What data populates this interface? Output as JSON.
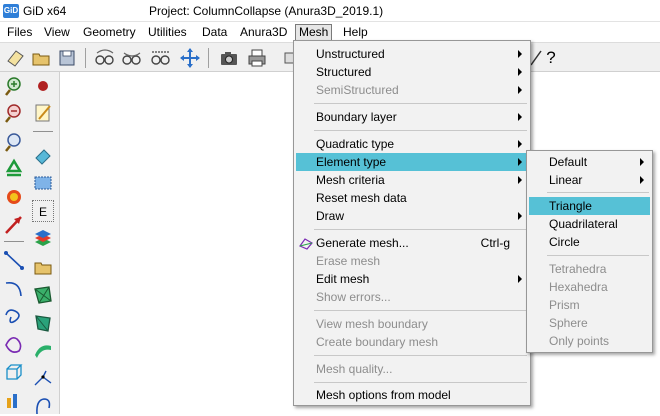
{
  "window": {
    "app_name": "GiD x64",
    "title": "Project: ColumnCollapse (Anura3D_2019.1)"
  },
  "menubar": [
    {
      "label": "Files"
    },
    {
      "label": "View"
    },
    {
      "label": "Geometry"
    },
    {
      "label": "Utilities"
    },
    {
      "label": "Data"
    },
    {
      "label": "Anura3D"
    },
    {
      "label": "Mesh",
      "active": true
    },
    {
      "label": "Help"
    }
  ],
  "toolbar": {
    "help_glyph": "?",
    "icons": [
      "new-file-icon",
      "open-folder-icon",
      "save-icon",
      "zoom-in-icon",
      "zoom-out-icon",
      "rotate-icon",
      "pan-icon",
      "screenshot-camera-icon",
      "print-icon",
      "help-icon"
    ]
  },
  "sidebar": {
    "e_label": "E"
  },
  "mesh_menu": {
    "items": [
      {
        "label": "Unstructured",
        "submenu": true
      },
      {
        "label": "Structured",
        "submenu": true
      },
      {
        "label": "SemiStructured",
        "submenu": true,
        "disabled": true
      },
      {
        "label": "Boundary layer",
        "submenu": true
      },
      {
        "label": "Quadratic type",
        "submenu": true
      },
      {
        "label": "Element type",
        "submenu": true,
        "highlighted": true
      },
      {
        "label": "Mesh criteria",
        "submenu": true
      },
      {
        "label": "Reset mesh data"
      },
      {
        "label": "Draw",
        "submenu": true
      },
      {
        "label": "Generate mesh...",
        "shortcut": "Ctrl-g",
        "icon": "generate-mesh-icon"
      },
      {
        "label": "Erase mesh",
        "disabled": true
      },
      {
        "label": "Edit mesh",
        "submenu": true
      },
      {
        "label": "Show errors...",
        "disabled": true
      },
      {
        "label": "View mesh boundary",
        "disabled": true
      },
      {
        "label": "Create boundary mesh",
        "disabled": true
      },
      {
        "label": "Mesh quality...",
        "disabled": true
      },
      {
        "label": "Mesh options from model"
      }
    ]
  },
  "element_type_menu": {
    "items": [
      {
        "label": "Default",
        "submenu": true
      },
      {
        "label": "Linear",
        "submenu": true
      },
      {
        "label": "Triangle",
        "highlighted": true
      },
      {
        "label": "Quadrilateral"
      },
      {
        "label": "Circle"
      },
      {
        "label": "Tetrahedra",
        "disabled": true
      },
      {
        "label": "Hexahedra",
        "disabled": true
      },
      {
        "label": "Prism",
        "disabled": true
      },
      {
        "label": "Sphere",
        "disabled": true
      },
      {
        "label": "Only points",
        "disabled": true
      }
    ]
  },
  "colors": {
    "highlight": "#56c1d6",
    "disabled_text": "#8d8d8d",
    "menu_bg": "#f2f2f2"
  }
}
